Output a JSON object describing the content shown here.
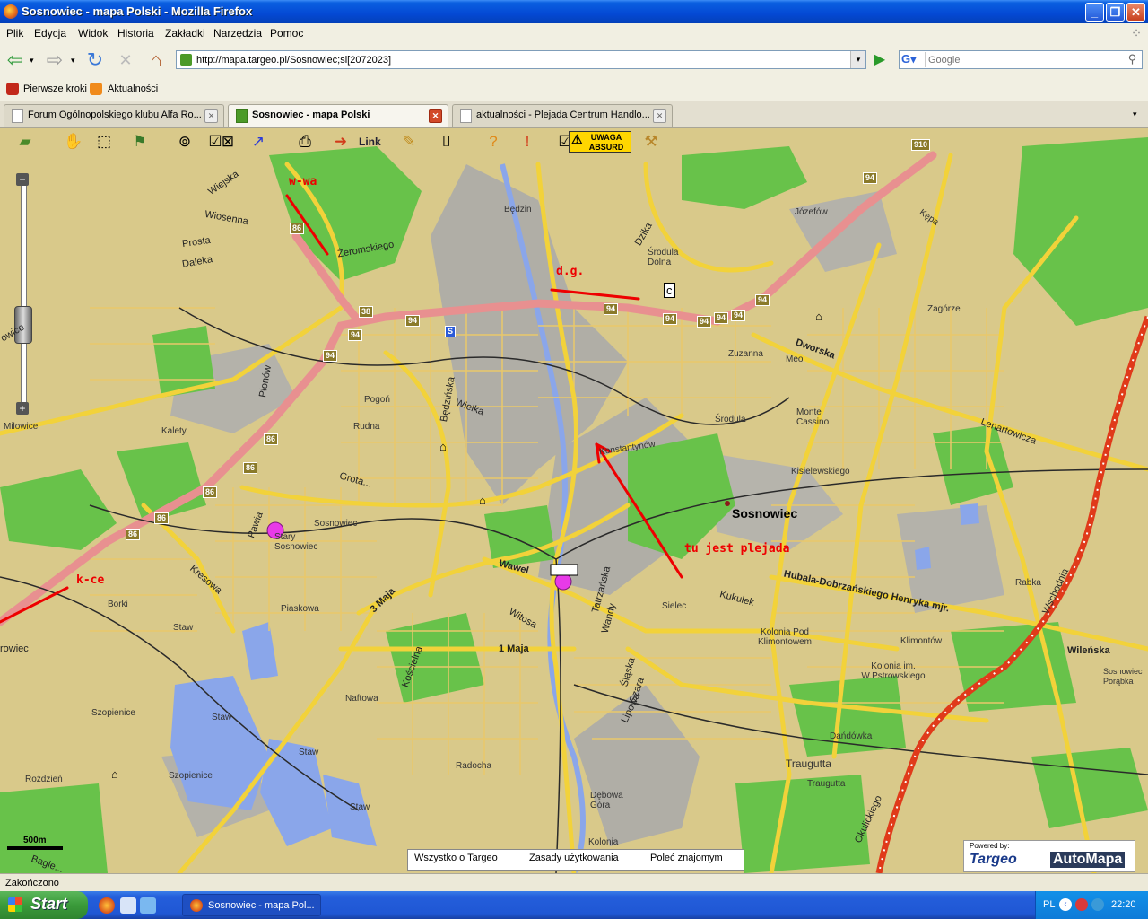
{
  "window": {
    "title": "Sosnowiec - mapa Polski - Mozilla Firefox",
    "minimize": "_",
    "maximize": "❐",
    "close": "✕"
  },
  "menu": [
    "Plik",
    "Edycja",
    "Widok",
    "Historia",
    "Zakładki",
    "Narzędzia",
    "Pomoc"
  ],
  "nav": {
    "url": "http://mapa.targeo.pl/Sosnowiec;si[2072023]",
    "search_placeholder": "Google",
    "back": "⇦",
    "forward": "⇨",
    "reload": "↻",
    "stop": "✕",
    "home": "⌂",
    "go": "▶"
  },
  "bookmarks": [
    "Pierwsze kroki",
    "Aktualności"
  ],
  "tabs": [
    {
      "label": "Forum Ogólnopolskiego klubu Alfa Ro...",
      "active": false
    },
    {
      "label": "Sosnowiec - mapa Polski",
      "active": true
    },
    {
      "label": "aktualności - Plejada Centrum Handlo...",
      "active": false
    }
  ],
  "map_toolbar": {
    "link": "Link",
    "warning_line1": "UWAGA",
    "warning_line2": "ABSURD"
  },
  "map": {
    "city": "Sosnowiec",
    "places": [
      "Będzin",
      "Środula Dolna",
      "Józefów",
      "Kępa",
      "Zagórze",
      "Zuzanna",
      "Meo",
      "Monte Cassino",
      "Środula",
      "Pogoń",
      "Rudna",
      "Kalety",
      "Milowice",
      "Konstantynów",
      "Kisielewskiego",
      "Stary Sosnowiec",
      "Sosnowiec",
      "Borki",
      "Piaskowa",
      "Sielec",
      "Kolonia Pod Klimontowem",
      "Klimontów",
      "Kolonia im. W.Pstrowskiego",
      "Sosnowiec Porąbka",
      "Rabka",
      "Szopienice",
      "Rożdzień",
      "Naftowa",
      "Radocha",
      "Dębowa Góra",
      "Kolonia",
      "Dańdówka",
      "Trauguttа",
      "Traugutta",
      "Staw",
      "Staw",
      "Staw",
      "Staw",
      "Staw"
    ],
    "roads": [
      "Wiejska",
      "Wiosenna",
      "Prosta",
      "Daleka",
      "Żeromskiego",
      "Dzika",
      "Dworska",
      "Lenartowicza",
      "Płonów",
      "Będzińska",
      "Wielka",
      "Grota...",
      "Pawia",
      "Kresowa",
      "3 Maja",
      "Wawel",
      "Witosa",
      "1 Maja",
      "Kościelna",
      "Tatrzańska",
      "Wandy",
      "Śląska",
      "Lipowa",
      "Szara",
      "Kukułek",
      "Hubala-Dobrzańskiego Henryka mjr.",
      "Wileńska",
      "Wschodnia",
      "Okulickiego",
      "Bagie...",
      "owice",
      "rowiec"
    ],
    "route_numbers": [
      "86",
      "86",
      "86",
      "86",
      "86",
      "86",
      "38",
      "94",
      "94",
      "94",
      "94",
      "94",
      "94",
      "94",
      "94",
      "94",
      "910",
      "S"
    ],
    "annotations": [
      "w-wa",
      "d.g.",
      "k-ce",
      "tu jest plejada"
    ],
    "scale": "500m",
    "footer": [
      "Wszystko o Targeo",
      "Zasady użytkowania",
      "Poleć znajomym"
    ],
    "powered_by": "Powered by:",
    "brand_1": "Targeo",
    "brand_2": "AutoMapa"
  },
  "status": "Zakończono",
  "taskbar": {
    "start": "Start",
    "task": "Sosnowiec - mapa Pol...",
    "lang": "PL",
    "clock": "22:20"
  },
  "colors": {
    "land": "#d9c98a",
    "green": "#68c24a",
    "water": "#8aa6ea",
    "urban": "#b0aea6",
    "main_road": "#f2d23a",
    "expressway": "#e89090",
    "railway": "#e03a1a",
    "annotation": "#ee0000"
  }
}
